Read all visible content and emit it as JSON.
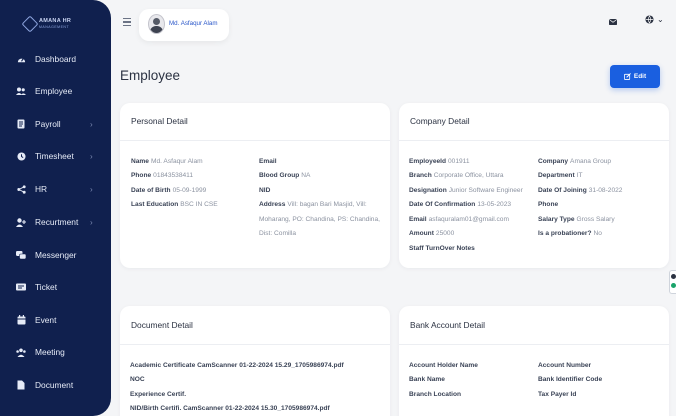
{
  "app": {
    "logo_line1": "AMANA HR",
    "logo_line2": "MANAGEMENT"
  },
  "sidebar": {
    "items": [
      {
        "label": "Dashboard",
        "icon": "gauge-icon",
        "chevron": false
      },
      {
        "label": "Employee",
        "icon": "users-icon",
        "chevron": false
      },
      {
        "label": "Payroll",
        "icon": "document-icon",
        "chevron": true
      },
      {
        "label": "Timesheet",
        "icon": "clock-icon",
        "chevron": true
      },
      {
        "label": "HR",
        "icon": "share-icon",
        "chevron": true
      },
      {
        "label": "Recurtment",
        "icon": "user-plus-icon",
        "chevron": true
      },
      {
        "label": "Messenger",
        "icon": "chat-icon",
        "chevron": false
      },
      {
        "label": "Ticket",
        "icon": "ticket-icon",
        "chevron": false
      },
      {
        "label": "Event",
        "icon": "calendar-icon",
        "chevron": false
      },
      {
        "label": "Meeting",
        "icon": "meeting-icon",
        "chevron": false
      },
      {
        "label": "Document",
        "icon": "file-icon",
        "chevron": false
      }
    ],
    "chevron_glyph": "›"
  },
  "topbar": {
    "user_name": "Md. Asfaqur Alam",
    "lang_caret": "⌄"
  },
  "page": {
    "title": "Employee",
    "edit_label": "Edit"
  },
  "personal": {
    "title": "Personal Detail",
    "name_k": "Name",
    "name_v": "Md. Asfaqur Alam",
    "phone_k": "Phone",
    "phone_v": "01843538411",
    "dob_k": "Date of Birth",
    "dob_v": "05-09-1999",
    "edu_k": "Last Education",
    "edu_v": "BSC IN CSE",
    "email_k": "Email",
    "email_v": "",
    "blood_k": "Blood Group",
    "blood_v": "NA",
    "nid_k": "NID",
    "nid_v": "",
    "address_k": "Address",
    "address_v": "Vill: bagan Bari Masjid, Vill: Moharang, PO: Chandina, PS: Chandina, Dist: Comilla"
  },
  "company": {
    "title": "Company Detail",
    "empid_k": "EmployeeId",
    "empid_v": "001911",
    "branch_k": "Branch",
    "branch_v": "Corporate Office, Uttara",
    "desig_k": "Designation",
    "desig_v": "Junior Software Engineer",
    "doc_k": "Date Of Confirmation",
    "doc_v": "13-05-2023",
    "email_k": "Email",
    "email_v": "asfaquralam01@gmail.com",
    "amount_k": "Amount",
    "amount_v": "25000",
    "turnover_k": "Staff TurnOver Notes",
    "turnover_v": "",
    "company_k": "Company",
    "company_v": "Amana Group",
    "dept_k": "Department",
    "dept_v": "IT",
    "doj_k": "Date Of Joining",
    "doj_v": "31-08-2022",
    "phone_k": "Phone",
    "phone_v": "",
    "salary_k": "Salary Type",
    "salary_v": "Gross Salary",
    "probation_k": "Is a probationer?",
    "probation_v": "No"
  },
  "documents": {
    "title": "Document Detail",
    "rows": [
      "Academic Certificate CamScanner 01-22-2024 15.29_1705986974.pdf",
      "NOC",
      "Experience Certif.",
      "NID/Birth Certifi. CamScanner 01-22-2024 15.30_1705986974.pdf"
    ]
  },
  "bank": {
    "title": "Bank Account Detail",
    "holder_k": "Account Holder Name",
    "holder_v": "",
    "bank_k": "Bank Name",
    "bank_v": "",
    "branch_k": "Branch Location",
    "branch_v": "",
    "number_k": "Account Number",
    "number_v": "",
    "bic_k": "Bank Identifier Code",
    "bic_v": "",
    "tax_k": "Tax Payer Id",
    "tax_v": ""
  }
}
